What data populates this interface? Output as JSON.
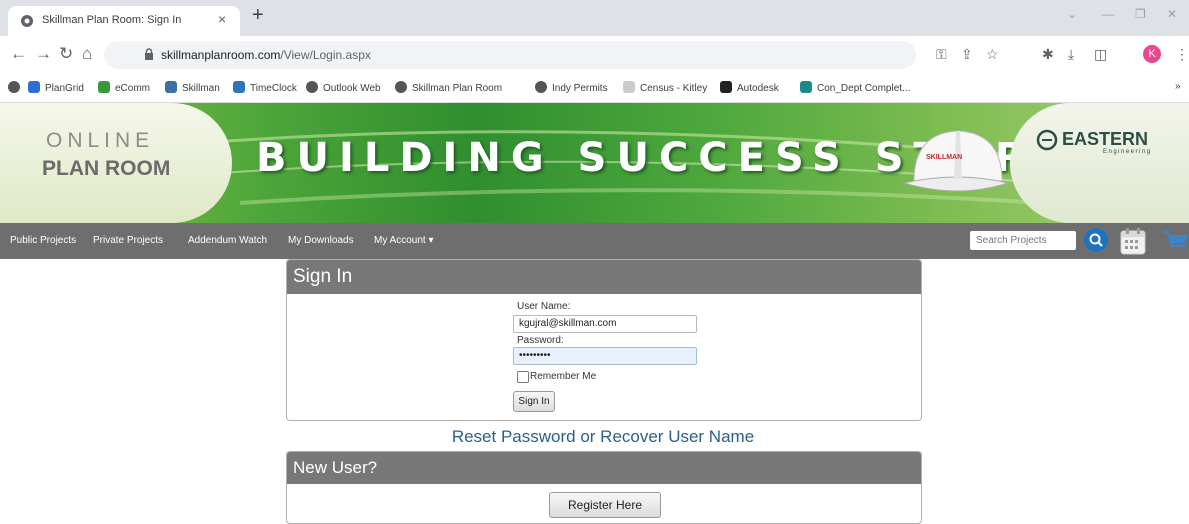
{
  "browser": {
    "tab_title": "Skillman Plan Room: Sign In",
    "close_glyph": "×",
    "new_tab_glyph": "+",
    "url_host": "skillmanplanroom.com",
    "url_path": "/View/Login.aspx",
    "profile_initial": "K"
  },
  "bookmarks": [
    {
      "label": "PlanGrid",
      "color": "#2b6fd6"
    },
    {
      "label": "eComm",
      "color": "#3a9a3a"
    },
    {
      "label": "Skillman",
      "color": "#3a6fa8"
    },
    {
      "label": "TimeClock",
      "color": "#2e74c0"
    },
    {
      "label": "Outlook Web",
      "color": "#555555"
    },
    {
      "label": "Skillman Plan Room",
      "color": "#555555"
    },
    {
      "label": "Indy Permits",
      "color": "#555555"
    },
    {
      "label": "Census - Kitley",
      "color": "#cccccc"
    },
    {
      "label": "Autodesk",
      "color": "#222222"
    },
    {
      "label": "Con_Dept Complet...",
      "color": "#1a8a8a"
    }
  ],
  "banner": {
    "online": "ONLINE",
    "plan_room": "PLAN ROOM",
    "headline": "BUILDING SUCCESS STORIES",
    "hat_text": "SKILLMAN",
    "brand": "EASTERN",
    "brand_sub": "Engineering"
  },
  "nav": {
    "items": [
      "Public Projects",
      "Private Projects",
      "Addendum Watch",
      "My Downloads",
      "My Account ▾"
    ],
    "search_placeholder": "Search Projects"
  },
  "signin": {
    "title": "Sign In",
    "username_label": "User Name:",
    "username_value": "kgujral@skillman.com",
    "password_label": "Password:",
    "password_value": "•••••••••",
    "remember_label": "Remember Me",
    "button": "Sign In"
  },
  "reset_link": "Reset Password or Recover User Name",
  "newuser": {
    "title": "New User?",
    "button": "Register Here"
  },
  "colors": {
    "nav_bg": "#6e6e6e",
    "panel_header": "#787878",
    "link": "#2b5f8a",
    "search_button": "#1e73be"
  }
}
